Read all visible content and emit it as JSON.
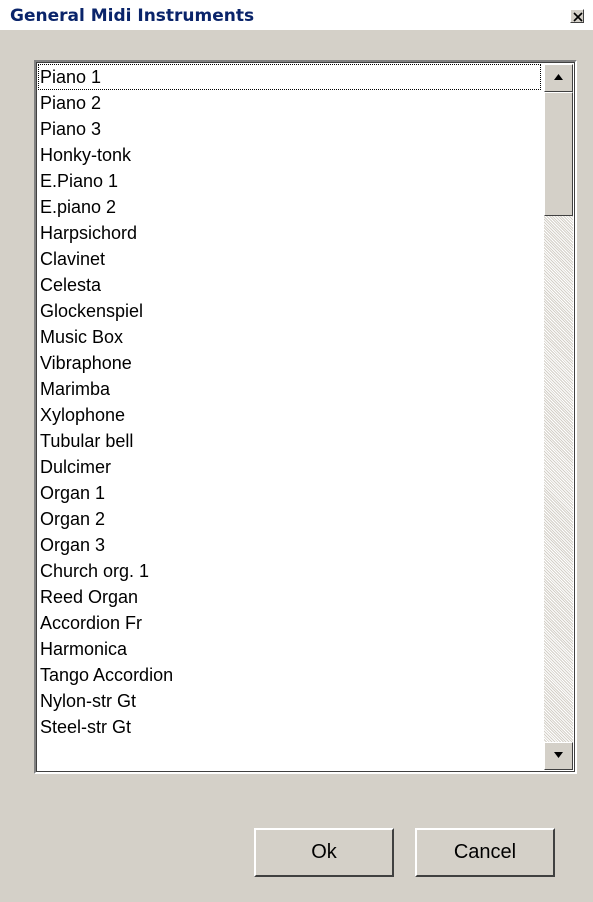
{
  "window": {
    "title": "General Midi Instruments"
  },
  "instruments": [
    "Piano 1",
    "Piano 2",
    "Piano 3",
    "Honky-tonk",
    "E.Piano 1",
    "E.piano 2",
    "Harpsichord",
    "Clavinet",
    "Celesta",
    "Glockenspiel",
    "Music Box",
    "Vibraphone",
    "Marimba",
    "Xylophone",
    "Tubular bell",
    "Dulcimer",
    "Organ 1",
    "Organ 2",
    "Organ 3",
    "Church org. 1",
    "Reed Organ",
    "Accordion Fr",
    "Harmonica",
    "Tango Accordion",
    "Nylon-str Gt",
    "Steel-str Gt"
  ],
  "focused_item": "Piano 1",
  "buttons": {
    "ok": "Ok",
    "cancel": "Cancel"
  },
  "icons": {
    "close": "close-icon",
    "scroll_up": "arrow-up-icon",
    "scroll_down": "arrow-down-icon"
  },
  "colors": {
    "title_text": "#0a246a",
    "dialog_face": "#d4d0c8"
  }
}
